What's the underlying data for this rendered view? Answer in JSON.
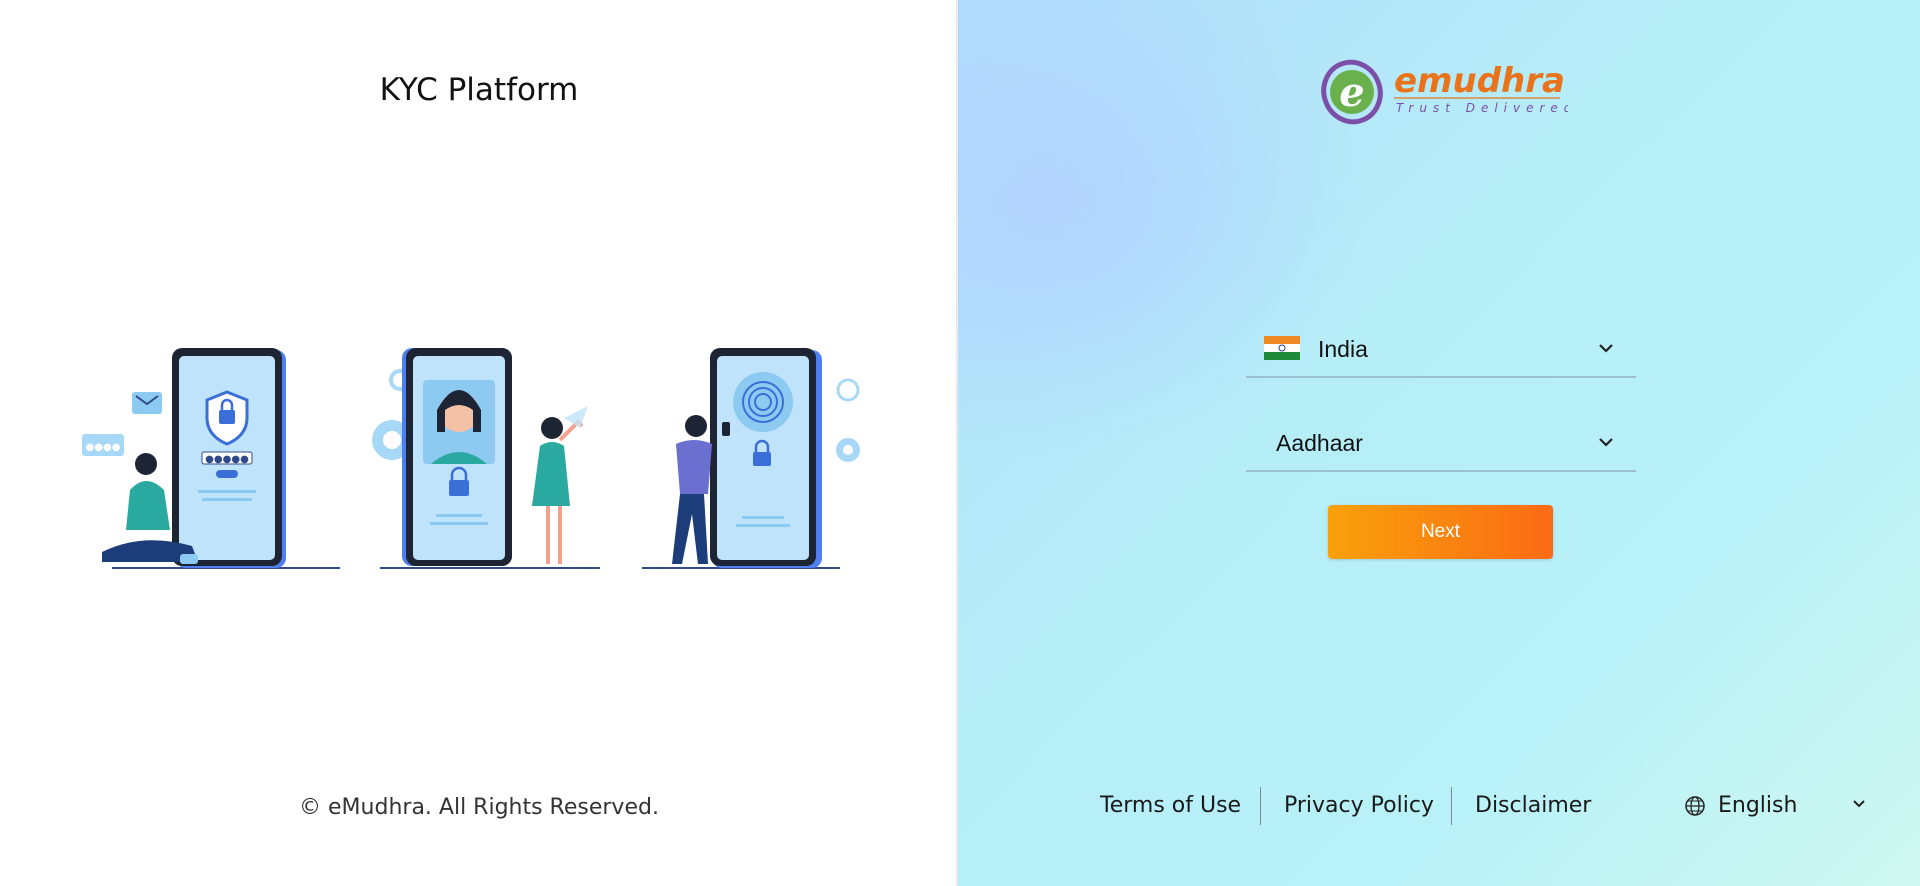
{
  "left": {
    "title": "KYC Platform",
    "copyright": "© eMudhra. All Rights Reserved."
  },
  "brand": {
    "name": "emudhra",
    "tagline": "Trust Delivered",
    "logo_letter": "e"
  },
  "form": {
    "country": {
      "value": "India",
      "flag_icon": "india-flag-icon"
    },
    "document_type": {
      "value": "Aadhaar"
    },
    "next_label": "Next"
  },
  "footer": {
    "terms": "Terms of Use",
    "privacy": "Privacy Policy",
    "disclaimer": "Disclaimer",
    "language": "English"
  },
  "colors": {
    "accent_orange_start": "#f8a10a",
    "accent_orange_end": "#fc6a15",
    "brand_orange": "#e8731a",
    "brand_purple": "#7b4fa8",
    "brand_green": "#6ab04c"
  }
}
